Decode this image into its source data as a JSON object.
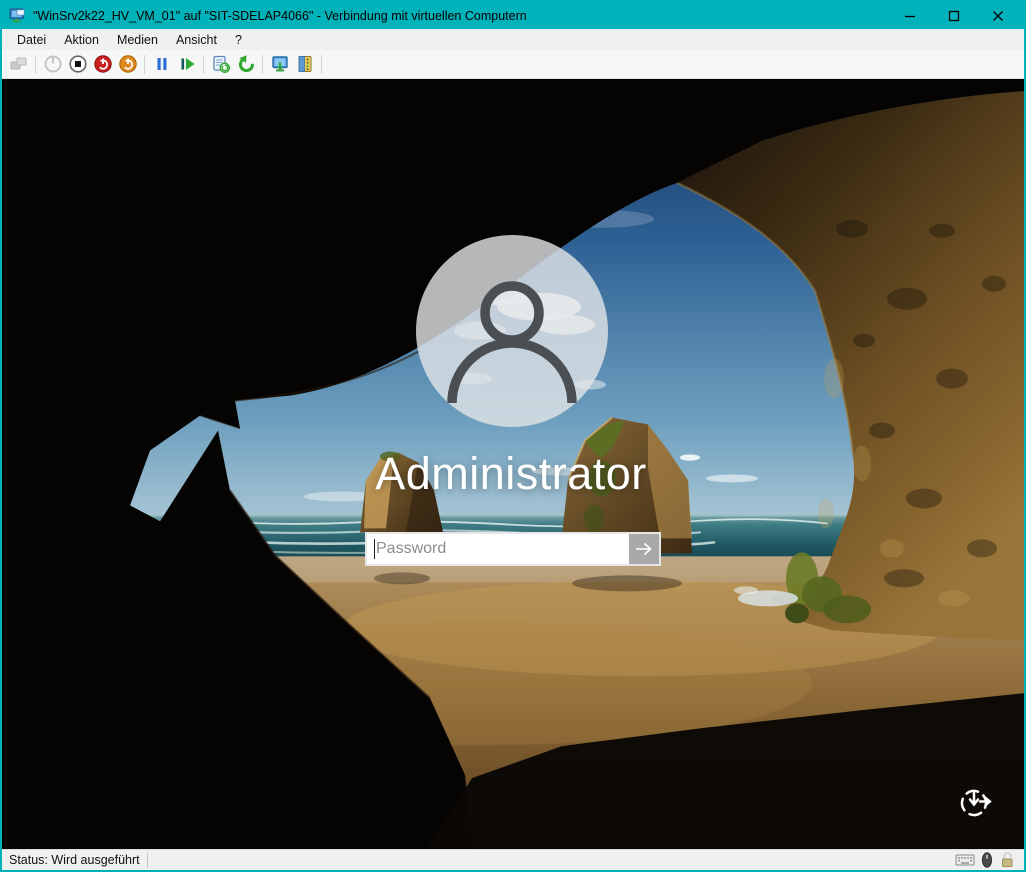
{
  "window": {
    "title": "\"WinSrv2k22_HV_VM_01\" auf \"SIT-SDELAP4066\" - Verbindung mit virtuellen Computern"
  },
  "menu": {
    "items": [
      "Datei",
      "Aktion",
      "Medien",
      "Ansicht",
      "?"
    ]
  },
  "toolbar": {
    "icons": [
      "ctrl-alt-del",
      "start",
      "turn-off",
      "shut-down",
      "save",
      "pause",
      "resume",
      "checkpoint",
      "revert",
      "basic-session",
      "devices"
    ]
  },
  "login": {
    "username": "Administrator",
    "password_placeholder": "Password",
    "corner_icon": "clock-arrows"
  },
  "status": {
    "text": "Status: Wird ausgeführt",
    "indicators": [
      "keyboard",
      "mouse",
      "lock-unlocked"
    ]
  },
  "colors": {
    "titlebar": "#00b2ba",
    "window_border": "#00b2ba",
    "menu_bg": "#f0f0f0",
    "toolbar_bg": "#f7f7f7",
    "status_bg": "#f0f0f0",
    "vm_bg": "#020202",
    "accent_red": "#c92121",
    "accent_orange": "#e0891f",
    "accent_green": "#2fa32f",
    "accent_blue": "#2b6fd4"
  }
}
